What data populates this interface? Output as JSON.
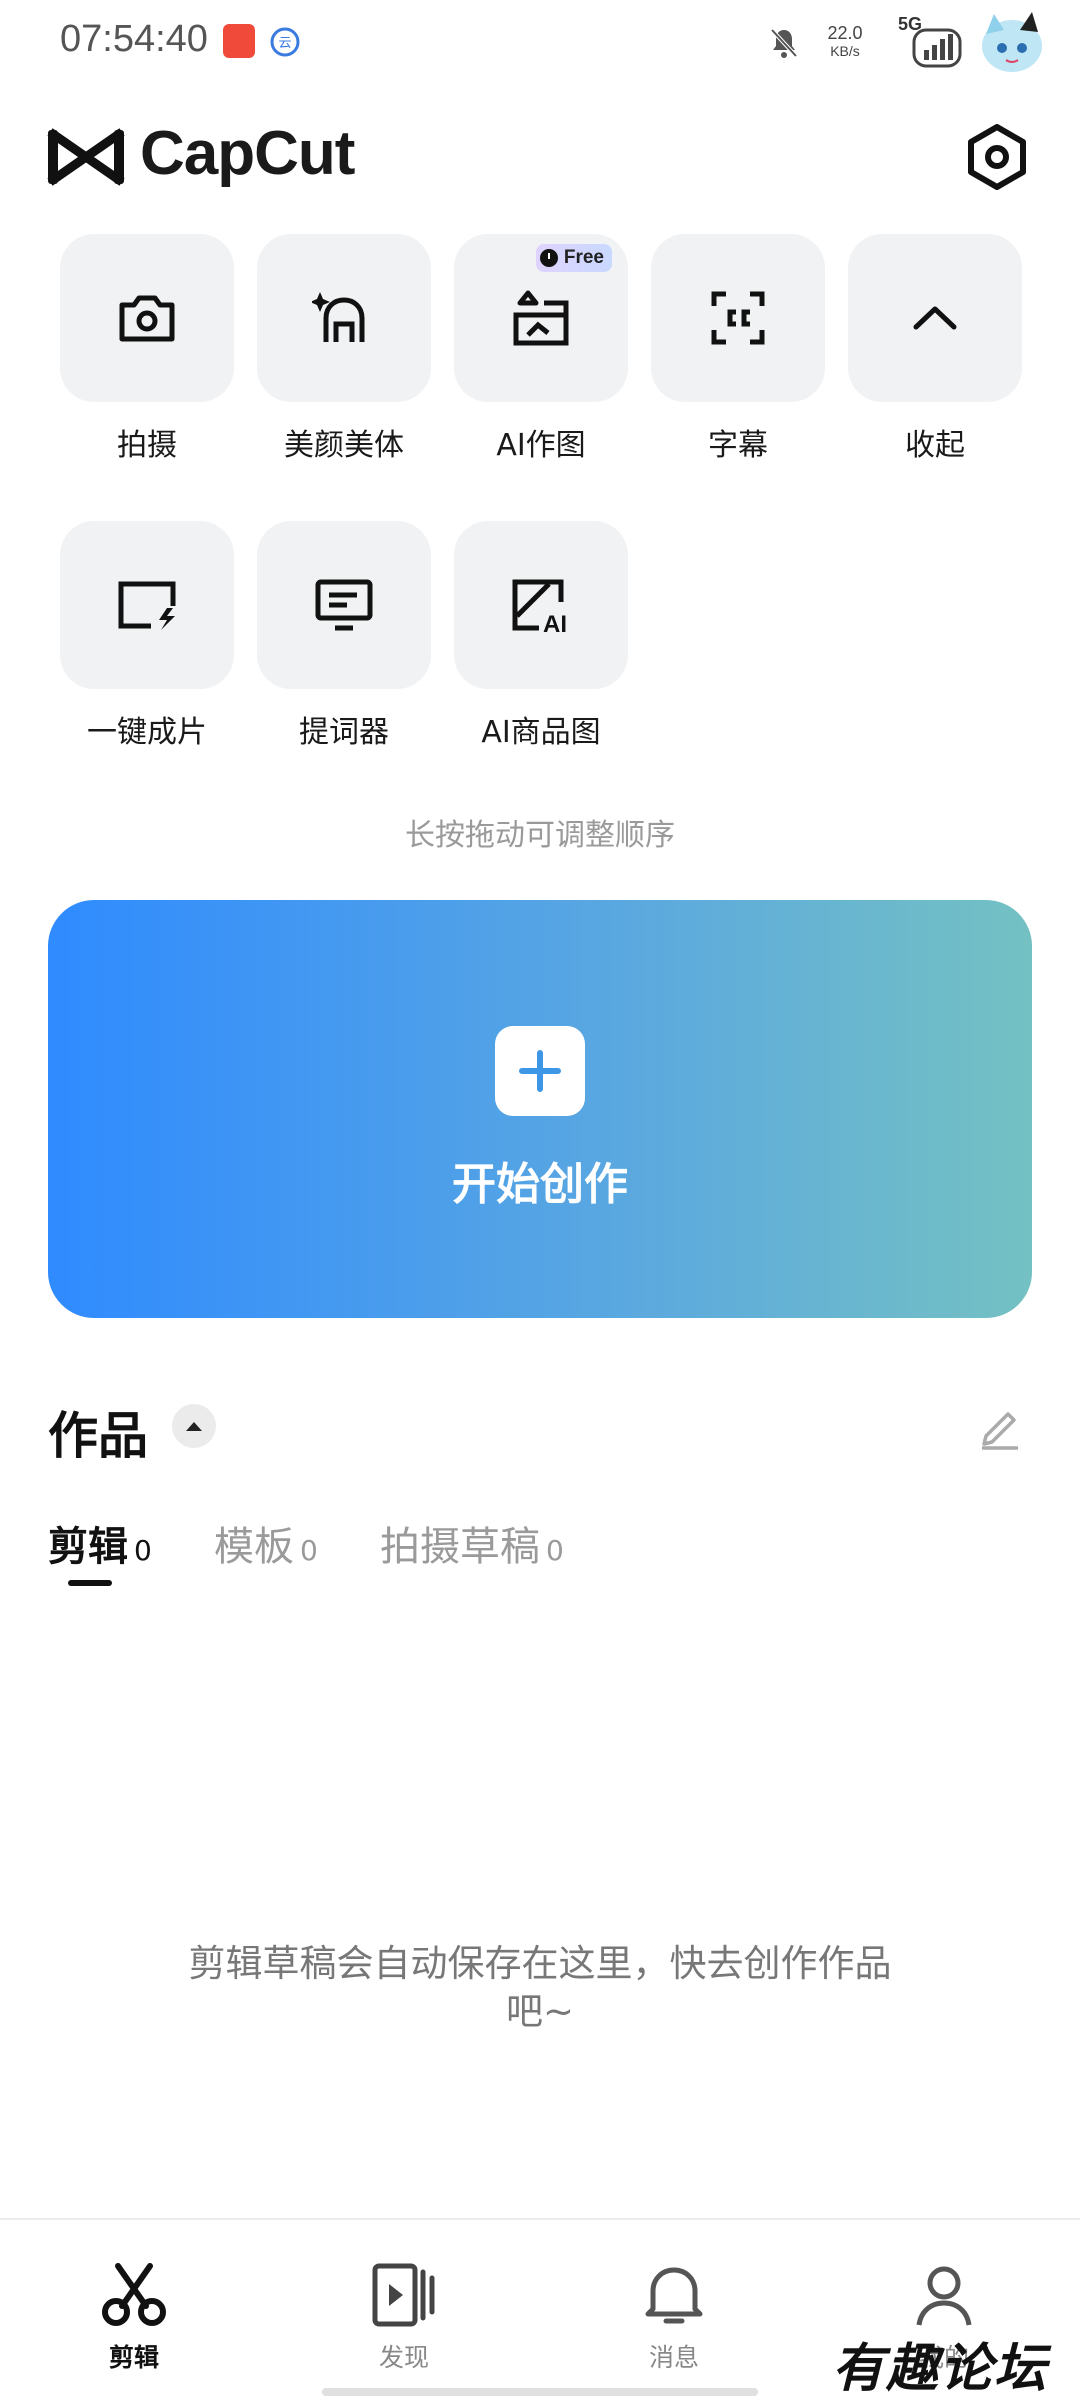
{
  "status_bar": {
    "time": "07:54:40",
    "speed_value": "22.0",
    "speed_unit": "KB/s",
    "network": "5G"
  },
  "header": {
    "logo_text": "CapCut"
  },
  "tools": [
    {
      "label": "拍摄",
      "icon": "camera-icon"
    },
    {
      "label": "美颜美体",
      "icon": "beauty-icon"
    },
    {
      "label": "AI作图",
      "icon": "ai-image-icon",
      "badge": "Free"
    },
    {
      "label": "字幕",
      "icon": "caption-icon"
    },
    {
      "label": "收起",
      "icon": "chevron-up-icon"
    },
    {
      "label": "一键成片",
      "icon": "quick-video-icon"
    },
    {
      "label": "提词器",
      "icon": "teleprompter-icon"
    },
    {
      "label": "AI商品图",
      "icon": "ai-product-icon"
    }
  ],
  "hint": "长按拖动可调整顺序",
  "create": {
    "label": "开始创作"
  },
  "works": {
    "title": "作品",
    "tabs": [
      {
        "label": "剪辑",
        "count": "0",
        "active": true
      },
      {
        "label": "模板",
        "count": "0",
        "active": false
      },
      {
        "label": "拍摄草稿",
        "count": "0",
        "active": false
      }
    ],
    "empty_message": "剪辑草稿会自动保存在这里，快去创作作品吧~"
  },
  "bottom_nav": [
    {
      "label": "剪辑",
      "icon": "scissors-icon",
      "active": true
    },
    {
      "label": "发现",
      "icon": "discover-icon",
      "active": false
    },
    {
      "label": "消息",
      "icon": "bell-icon",
      "active": false
    },
    {
      "label": "我的",
      "icon": "profile-icon",
      "active": false
    }
  ],
  "watermark": "有趣论坛",
  "colors": {
    "card_gradient_start": "#2f8bff",
    "card_gradient_end": "#74c1c3",
    "tile_bg": "#f1f2f4"
  }
}
